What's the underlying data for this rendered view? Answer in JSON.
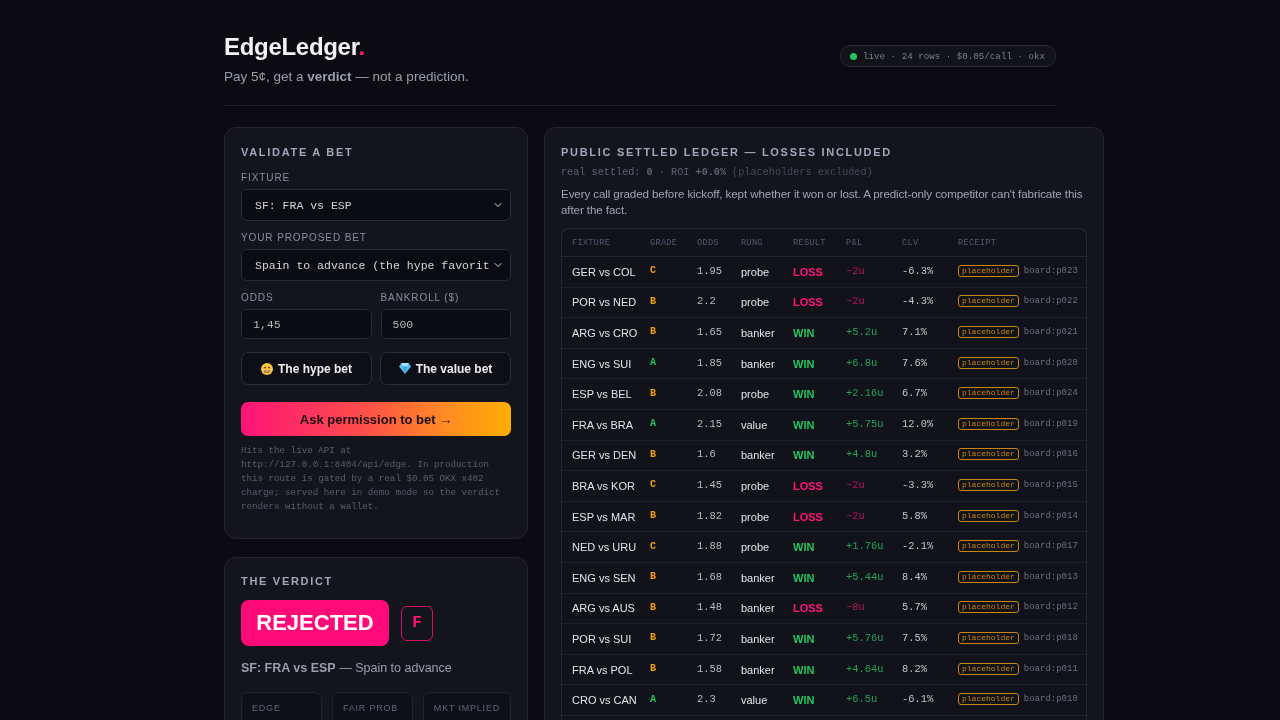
{
  "header": {
    "brand": {
      "name": "EdgeLedger",
      "dot": "."
    },
    "tagline": "Pay 5¢, get a **verdict** — not a prediction.",
    "status_pill": {
      "online": true,
      "text": "live · 24 rows · $0.05/call · okx"
    }
  },
  "validate_panel": {
    "title": "VALIDATE A BET",
    "fixture": {
      "label": "FIXTURE",
      "value": "SF: FRA vs ESP"
    },
    "proposed_bet": {
      "label": "YOUR PROPOSED BET",
      "value": "Spain to advance (the hype favorit"
    },
    "odds": {
      "label": "ODDS",
      "value": "1,45"
    },
    "bankroll": {
      "label": "BANKROLL ($)",
      "value": "500"
    },
    "presets": [
      {
        "kind": "hype",
        "label": "The hype bet"
      },
      {
        "kind": "value",
        "label": "The value bet"
      }
    ],
    "submit": "Ask permission to bet →",
    "note": "Hits the live API at http://127.0.0.1:8404/api/edge. In production this route is gated by a real $0.05 OKX x402 charge; served here in demo mode so the verdict renders without a wallet."
  },
  "verdict_panel": {
    "title": "THE VERDICT",
    "verdict": "REJECTED",
    "approved": false,
    "grade": "F",
    "summary": "**SF: FRA vs ESP** — Spain to advance",
    "metrics": [
      {
        "label": "EDGE"
      },
      {
        "label": "FAIR PROB"
      },
      {
        "label": "MKT IMPLIED"
      }
    ]
  },
  "ledger_panel": {
    "title": "PUBLIC SETTLED LEDGER — LOSSES INCLUDED",
    "stats": "real settled: **0** · ROI **+0.0%**",
    "stats_note": "(placeholders excluded)",
    "description": "Every call graded before kickoff, kept whether it won or lost. A predict-only competitor can't fabricate this after the fact.",
    "table": {
      "columns": [
        "FIXTURE",
        "GRADE",
        "ODDS",
        "RUNG",
        "RESULT",
        "P&L",
        "CLV",
        "RECEIPT"
      ],
      "rows": [
        {
          "fixture": "GER vs COL",
          "grade": "C",
          "color": "#f59e0b",
          "odds": "1.95",
          "rung": "probe",
          "result": "LOSS",
          "won": false,
          "pnl": "−2u",
          "clv": "-6.3%",
          "tag": "placeholder",
          "receipt": "board:p023"
        },
        {
          "fixture": "POR vs NED",
          "grade": "B",
          "color": "#f59e0b",
          "odds": "2.2",
          "rung": "probe",
          "result": "LOSS",
          "won": false,
          "pnl": "−2u",
          "clv": "-4.3%",
          "tag": "placeholder",
          "receipt": "board:p022"
        },
        {
          "fixture": "ARG vs CRO",
          "grade": "B",
          "color": "#f59e0b",
          "odds": "1.65",
          "rung": "banker",
          "result": "WIN",
          "won": true,
          "pnl": "+5.2u",
          "clv": "7.1%",
          "tag": "placeholder",
          "receipt": "board:p021"
        },
        {
          "fixture": "ENG vs SUI",
          "grade": "A",
          "color": "#22c55e",
          "odds": "1.85",
          "rung": "banker",
          "result": "WIN",
          "won": true,
          "pnl": "+6.8u",
          "clv": "7.6%",
          "tag": "placeholder",
          "receipt": "board:p020"
        },
        {
          "fixture": "ESP vs BEL",
          "grade": "B",
          "color": "#f59e0b",
          "odds": "2.08",
          "rung": "probe",
          "result": "WIN",
          "won": true,
          "pnl": "+2.16u",
          "clv": "6.7%",
          "tag": "placeholder",
          "receipt": "board:p024"
        },
        {
          "fixture": "FRA vs BRA",
          "grade": "A",
          "color": "#22c55e",
          "odds": "2.15",
          "rung": "value",
          "result": "WIN",
          "won": true,
          "pnl": "+5.75u",
          "clv": "12.0%",
          "tag": "placeholder",
          "receipt": "board:p019"
        },
        {
          "fixture": "GER vs DEN",
          "grade": "B",
          "color": "#f59e0b",
          "odds": "1.6",
          "rung": "banker",
          "result": "WIN",
          "won": true,
          "pnl": "+4.8u",
          "clv": "3.2%",
          "tag": "placeholder",
          "receipt": "board:p016"
        },
        {
          "fixture": "BRA vs KOR",
          "grade": "C",
          "color": "#f59e0b",
          "odds": "1.45",
          "rung": "probe",
          "result": "LOSS",
          "won": false,
          "pnl": "−2u",
          "clv": "-3.3%",
          "tag": "placeholder",
          "receipt": "board:p015"
        },
        {
          "fixture": "ESP vs MAR",
          "grade": "B",
          "color": "#f59e0b",
          "odds": "1.82",
          "rung": "probe",
          "result": "LOSS",
          "won": false,
          "pnl": "−2u",
          "clv": "5.8%",
          "tag": "placeholder",
          "receipt": "board:p014"
        },
        {
          "fixture": "NED vs URU",
          "grade": "C",
          "color": "#f59e0b",
          "odds": "1.88",
          "rung": "probe",
          "result": "WIN",
          "won": true,
          "pnl": "+1.76u",
          "clv": "-2.1%",
          "tag": "placeholder",
          "receipt": "board:p017"
        },
        {
          "fixture": "ENG vs SEN",
          "grade": "B",
          "color": "#f59e0b",
          "odds": "1.68",
          "rung": "banker",
          "result": "WIN",
          "won": true,
          "pnl": "+5.44u",
          "clv": "8.4%",
          "tag": "placeholder",
          "receipt": "board:p013"
        },
        {
          "fixture": "ARG vs AUS",
          "grade": "B",
          "color": "#f59e0b",
          "odds": "1.48",
          "rung": "banker",
          "result": "LOSS",
          "won": false,
          "pnl": "−8u",
          "clv": "5.7%",
          "tag": "placeholder",
          "receipt": "board:p012"
        },
        {
          "fixture": "POR vs SUI",
          "grade": "B",
          "color": "#f59e0b",
          "odds": "1.72",
          "rung": "banker",
          "result": "WIN",
          "won": true,
          "pnl": "+5.76u",
          "clv": "7.5%",
          "tag": "placeholder",
          "receipt": "board:p018"
        },
        {
          "fixture": "FRA vs POL",
          "grade": "B",
          "color": "#f59e0b",
          "odds": "1.58",
          "rung": "banker",
          "result": "WIN",
          "won": true,
          "pnl": "+4.64u",
          "clv": "8.2%",
          "tag": "placeholder",
          "receipt": "board:p011"
        },
        {
          "fixture": "CRO vs CAN",
          "grade": "A",
          "color": "#22c55e",
          "odds": "2.3",
          "rung": "value",
          "result": "WIN",
          "won": true,
          "pnl": "+6.5u",
          "clv": "-6.1%",
          "tag": "placeholder",
          "receipt": "board:p010"
        }
      ]
    }
  }
}
